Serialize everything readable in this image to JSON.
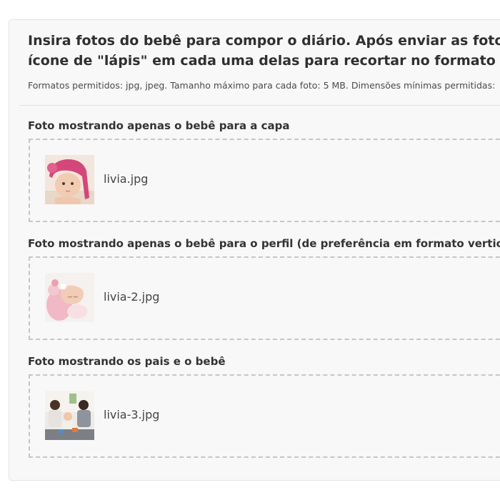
{
  "header": {
    "intro_line1": "Insira fotos do bebê para compor o diário. Após enviar as fotos seg",
    "intro_line2": "ícone de \"lápis\" em cada uma delas para recortar no formato ideal.",
    "formats": "Formatos permitidos: jpg, jpeg. Tamanho máximo para cada foto: 5 MB. Dimensões mínimas permitidas:"
  },
  "sections": [
    {
      "title": "Foto mostrando apenas o bebê para a capa",
      "filename": "livia.jpg",
      "thumb_icon": "baby-photo-thumbnail"
    },
    {
      "title": "Foto mostrando apenas o bebê para o perfil (de preferência em formato vertical)",
      "filename": "livia-2.jpg",
      "thumb_icon": "newborn-photo-thumbnail"
    },
    {
      "title": "Foto mostrando os pais e o bebê",
      "filename": "livia-3.jpg",
      "thumb_icon": "family-photo-thumbnail"
    }
  ],
  "colors": {
    "card_background": "#f8f8f8",
    "dropzone_border": "#c6c6c6",
    "text": "#333333"
  }
}
